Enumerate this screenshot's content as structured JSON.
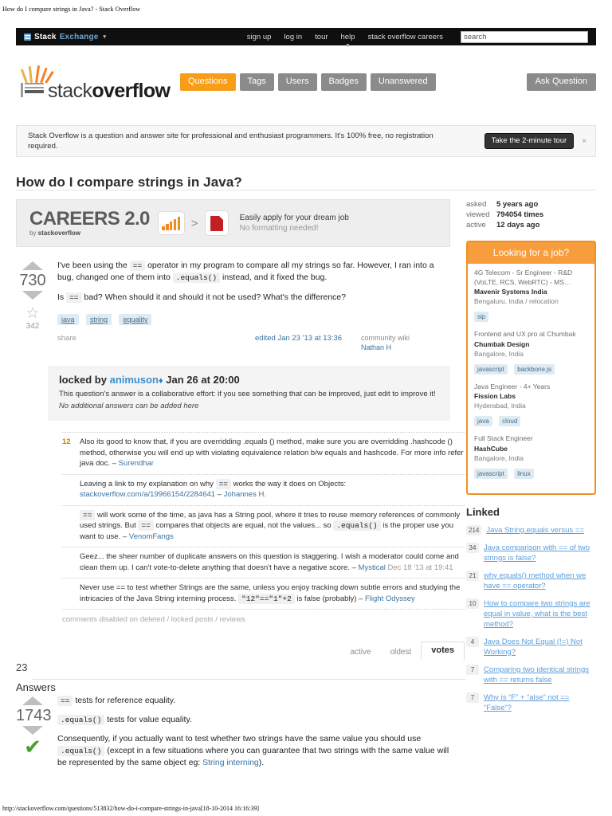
{
  "print_header": "How do I compare strings in Java? - Stack Overflow",
  "footer_url": "http://stackoverflow.com/questions/513832/how-do-i-compare-strings-in-java[18-10-2014 16:16:39]",
  "topbar": {
    "logo_stack": "Stack",
    "logo_exchange": "Exchange",
    "caret": "▾",
    "links": [
      {
        "label": "sign up"
      },
      {
        "label": "log in"
      },
      {
        "label": "tour"
      },
      {
        "label": "help"
      },
      {
        "label": "stack overflow careers"
      }
    ],
    "search_placeholder": "search",
    "search_value": "search"
  },
  "brand": {
    "logo_light": "stack",
    "logo_bold": "overflow",
    "tabs": [
      {
        "label": "Questions",
        "active": true
      },
      {
        "label": "Tags",
        "active": false
      },
      {
        "label": "Users",
        "active": false
      },
      {
        "label": "Badges",
        "active": false
      },
      {
        "label": "Unanswered",
        "active": false
      }
    ],
    "ask_label": "Ask Question"
  },
  "notice": {
    "text": "Stack Overflow is a question and answer site for professional and enthusiast programmers. It's 100% free, no registration required.",
    "button": "Take the 2-minute tour",
    "close": "×"
  },
  "question": {
    "title": "How do I compare strings in Java?",
    "votes": "730",
    "favorites": "342",
    "body_p1_a": "I've been using the ",
    "body_p1_code1": "==",
    "body_p1_b": " operator in my program to compare all my strings so far. However, I ran into a bug, changed one of them into ",
    "body_p1_code2": ".equals()",
    "body_p1_c": " instead, and it fixed the bug.",
    "body_p2_a": "Is ",
    "body_p2_code": "==",
    "body_p2_b": " bad? When should it and should it not be used? What's the difference?",
    "tags": [
      "java",
      "string",
      "equality"
    ],
    "share": "share",
    "edited": "edited Jan 23 '13 at 13:36",
    "wiki_label": "community wiki",
    "wiki_user": "Nathan H"
  },
  "locked": {
    "prefix": "locked by",
    "user": "animuson",
    "diamond": "♦",
    "date": "Jan 26 at 20:00",
    "line1": "This question's answer is a collaborative effort: if you see something that can be improved, just edit to improve it!",
    "line2": "No additional answers can be added here"
  },
  "comments": [
    {
      "score": "12",
      "text": "Also its good to know that, if you are overridding .equals () method, make sure you are overridding .hashcode () method, otherwise you will end up with violating equivalence relation b/w equals and hashcode. For more info refer java doc. – ",
      "user": "Surendhar",
      "date": ""
    },
    {
      "score": "",
      "text": "Leaving a link to my explanation on why ",
      "code": "==",
      "text2": " works the way it does on Objects: ",
      "link": "stackoverflow.com/a/19966154/2284641",
      "tail": " – ",
      "user": "Johannes H.",
      "date": ""
    },
    {
      "score": "",
      "code1": "==",
      "text": " will work some of the time, as java has a String pool, where it tries to reuse memory references of commonly used strings. But ",
      "code2": "==",
      "text2": " compares that objects are equal, not the values... so ",
      "code3": ".equals()",
      "text3": " is the proper use you want to use. – ",
      "user": "VenomFangs",
      "date": ""
    },
    {
      "score": "",
      "text": "Geez... the sheer number of duplicate answers on this question is staggering. I wish a moderator could come and clean them up. I can't vote-to-delete anything that doesn't have a negative score. – ",
      "user": "Mystical",
      "date": "Dec 18 '13 at 19:41"
    },
    {
      "score": "",
      "text": "Never use == to test whether Strings are the same, unless you enjoy  tracking down subtle errors and studying the intricacies of the Java String interning process. ",
      "code": "\"12\"==\"1\"+2",
      "text2": " is false (probably) – ",
      "user": "Flight Odyssey",
      "date": ""
    }
  ],
  "comments_disabled": "comments disabled on deleted / locked posts / reviews",
  "sort_tabs": [
    {
      "label": "active",
      "active": false
    },
    {
      "label": "oldest",
      "active": false
    },
    {
      "label": "votes",
      "active": true
    }
  ],
  "answers": {
    "count": "23",
    "heading": "Answers",
    "top": {
      "votes": "1743",
      "accepted_mark": "✔",
      "p1_code": "==",
      "p1_text": " tests for reference equality.",
      "p2_code": ".equals()",
      "p2_text": " tests for value equality.",
      "p3_a": "Consequently, if you actually want to test whether two strings have the same value you should use ",
      "p3_code": ".equals()",
      "p3_b": " (except in a few situations where you can guarantee that two strings with the same value will be represented by the same object eg: ",
      "p3_link": "String interning",
      "p3_c": ")."
    }
  },
  "careers_ad": {
    "brand_line1": "CAREERS 2.0",
    "brand_line2_a": "by ",
    "brand_line2_b": "stackoverflow",
    "gt": ">",
    "pdf_label": "PDF",
    "copy1": "Easily apply for your dream job",
    "copy2": "No formatting needed!"
  },
  "sidebar": {
    "stats": [
      {
        "key": "asked",
        "value": "5 years ago"
      },
      {
        "key": "viewed",
        "value": "794054 times"
      },
      {
        "key": "active",
        "value": "12 days ago"
      }
    ],
    "job_box_title": "Looking for a job?",
    "jobs": [
      {
        "title": "4G Telecom - Sr Engineer - R&D (VoLTE, RCS, WebRTC) - MS…",
        "company": "Mavenir Systems India",
        "location": "Bengaluru, India / relocation",
        "tags": [
          "sip"
        ]
      },
      {
        "title": "Frontend and UX pro at Chumbak",
        "company": "Chumbak Design",
        "location": "Bangalore, India",
        "tags": [
          "javascript",
          "backbone.js"
        ]
      },
      {
        "title": "Java Engineer - 4+ Years",
        "company": "Fission Labs",
        "location": "Hyderabad, India",
        "tags": [
          "java",
          "cloud"
        ]
      },
      {
        "title": "Full Stack Engineer",
        "company": "HashCube",
        "location": "Bangalore, India",
        "tags": [
          "javascript",
          "linux"
        ]
      }
    ],
    "linked_title": "Linked",
    "linked": [
      {
        "score": "214",
        "title": "Java String.equals versus =="
      },
      {
        "score": "34",
        "title": "Java comparison with == of two strings is false?"
      },
      {
        "score": "21",
        "title": "why equals() method when we have == operator?"
      },
      {
        "score": "10",
        "title": "How to compare two strings are equal in value, what is the best method?"
      },
      {
        "score": "4",
        "title": "Java Does Not Equal (!=) Not Working?"
      },
      {
        "score": "7",
        "title": "Comparing two identical strings with == returns false"
      },
      {
        "score": "7",
        "title": "Why is “F” + “alse” not == “False”?"
      }
    ]
  },
  "colors": {
    "accent_orange": "#f79d17",
    "link_blue": "#3b72a0",
    "tag_bg": "#e0eaf1",
    "accepted_green": "#4aa02c"
  }
}
